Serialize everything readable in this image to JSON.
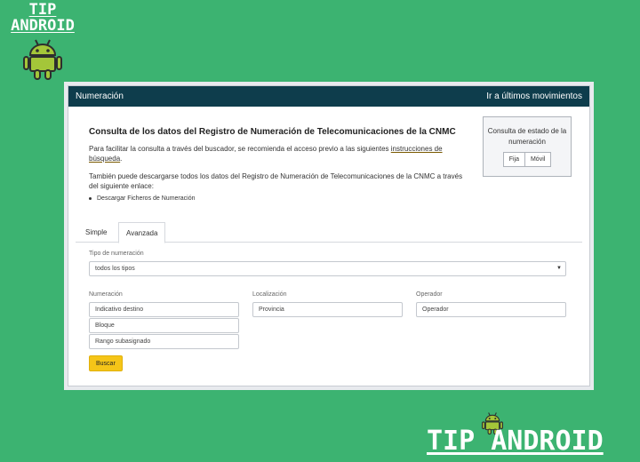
{
  "branding": {
    "top_left_line1": "TIP",
    "top_left_line2": "ANDROID",
    "bottom_right": "TIP ANDROID"
  },
  "header": {
    "title": "Numeración",
    "link": "Ir a últimos movimientos"
  },
  "intro": {
    "title": "Consulta de los datos del Registro de Numeración de Telecomunicaciones de la CNMC",
    "p1_text": "Para facilitar la consulta a través del buscador, se recomienda el acceso previo a las siguientes ",
    "p1_link": "instrucciones de búsqueda",
    "p1_end": ".",
    "p2_text": "También puede descargarse todos los datos del Registro de Numeración de Telecomunicaciones de la CNMC a través del siguiente enlace:",
    "bullet_link": "Descargar Ficheros de Numeración"
  },
  "status_box": {
    "label": "Consulta de estado de la numeración",
    "btn_fija": "Fija",
    "btn_movil": "Móvil"
  },
  "tabs": [
    {
      "label": "Simple",
      "active": false
    },
    {
      "label": "Avanzada",
      "active": true
    }
  ],
  "form": {
    "tipo_label": "Tipo de numeración",
    "tipo_value": "todos los tipos",
    "numeracion_label": "Numeración",
    "indicativo_placeholder": "Indicativo destino",
    "bloque_placeholder": "Bloque",
    "rango_placeholder": "Rango subasignado",
    "localizacion_label": "Localización",
    "provincia_placeholder": "Provincia",
    "operador_label": "Operador",
    "operador_placeholder": "Operador",
    "buscar_label": "Buscar"
  },
  "colors": {
    "background": "#3cb371",
    "header": "#0e3d4c",
    "button": "#f5c518"
  }
}
